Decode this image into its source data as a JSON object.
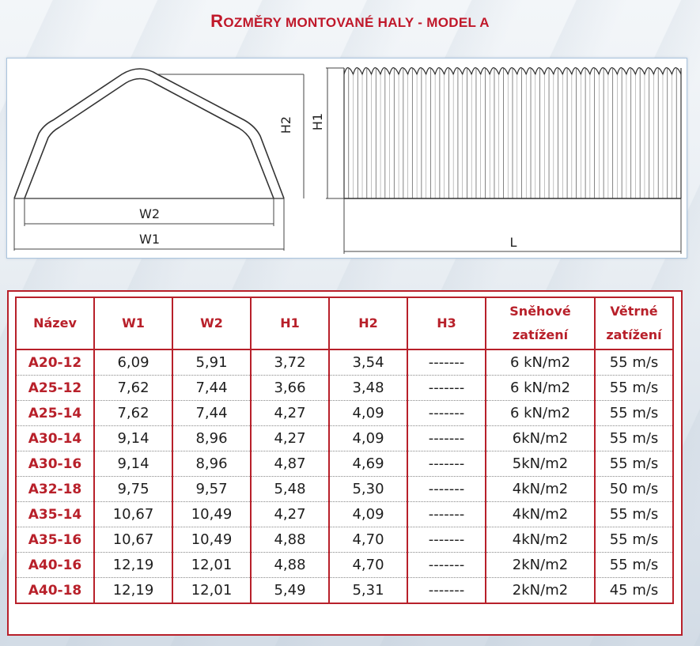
{
  "title": {
    "first": "R",
    "rest": "OZMĚRY MONTOVANÉ HALY - MODEL A"
  },
  "drawing": {
    "labels": {
      "h1": "H1",
      "h2": "H2",
      "w1": "W1",
      "w2": "W2",
      "l": "L"
    }
  },
  "table": {
    "headers": [
      {
        "line1": "Název",
        "line2": ""
      },
      {
        "line1": "W1",
        "line2": ""
      },
      {
        "line1": "W2",
        "line2": ""
      },
      {
        "line1": "H1",
        "line2": ""
      },
      {
        "line1": "H2",
        "line2": ""
      },
      {
        "line1": "H3",
        "line2": ""
      },
      {
        "line1": "Sněhové",
        "line2": "zatížení"
      },
      {
        "line1": "Větrné",
        "line2": "zatížení"
      }
    ],
    "rows": [
      [
        "A20-12",
        "6,09",
        "5,91",
        "3,72",
        "3,54",
        "-------",
        "6 kN/m2",
        "55 m/s"
      ],
      [
        "A25-12",
        "7,62",
        "7,44",
        "3,66",
        "3,48",
        "-------",
        "6 kN/m2",
        "55 m/s"
      ],
      [
        "A25-14",
        "7,62",
        "7,44",
        "4,27",
        "4,09",
        "-------",
        "6 kN/m2",
        "55 m/s"
      ],
      [
        "A30-14",
        "9,14",
        "8,96",
        "4,27",
        "4,09",
        "-------",
        "6kN/m2",
        "55 m/s"
      ],
      [
        "A30-16",
        "9,14",
        "8,96",
        "4,87",
        "4,69",
        "-------",
        "5kN/m2",
        "55 m/s"
      ],
      [
        "A32-18",
        "9,75",
        "9,57",
        "5,48",
        "5,30",
        "-------",
        "4kN/m2",
        "50 m/s"
      ],
      [
        "A35-14",
        "10,67",
        "10,49",
        "4,27",
        "4,09",
        "-------",
        "4kN/m2",
        "55 m/s"
      ],
      [
        "A35-16",
        "10,67",
        "10,49",
        "4,88",
        "4,70",
        "-------",
        "4kN/m2",
        "55 m/s"
      ],
      [
        "A40-16",
        "12,19",
        "12,01",
        "4,88",
        "4,70",
        "-------",
        "2kN/m2",
        "55 m/s"
      ],
      [
        "A40-18",
        "12,19",
        "12,01",
        "5,49",
        "5,31",
        "-------",
        "2kN/m2",
        "45 m/s"
      ]
    ]
  }
}
